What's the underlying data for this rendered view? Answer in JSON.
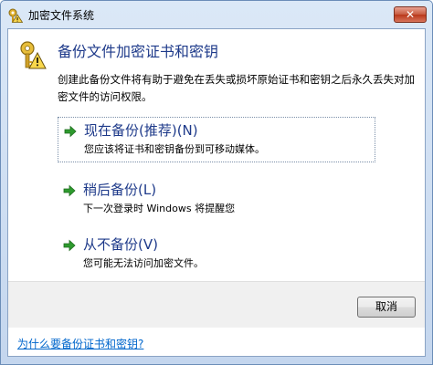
{
  "window": {
    "title": "加密文件系统",
    "close_glyph": "✕"
  },
  "content": {
    "heading": "备份文件加密证书和密钥",
    "description": "创建此备份文件将有助于避免在丢失或损坏原始证书和密钥之后永久丢失对加密文件的访问权限。"
  },
  "options": [
    {
      "title": "现在备份(推荐)(N)",
      "subtitle": "您应该将证书和密钥备份到可移动媒体。"
    },
    {
      "title": "稍后备份(L)",
      "subtitle": "下一次登录时 Windows 将提醒您"
    },
    {
      "title": "从不备份(V)",
      "subtitle": "您可能无法访问加密文件。"
    }
  ],
  "buttons": {
    "cancel_label": "取消"
  },
  "footer": {
    "help_link": "为什么要备份证书和密钥?"
  },
  "colors": {
    "heading": "#1e3a8a",
    "link": "#0066cc",
    "arrow": "#2e9b2e"
  }
}
